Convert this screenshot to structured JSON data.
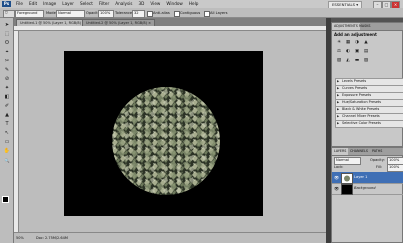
{
  "app": {
    "logo": "Ps"
  },
  "menu": [
    "File",
    "Edit",
    "Image",
    "Layer",
    "Select",
    "Filter",
    "Analysis",
    "3D",
    "View",
    "Window",
    "Help"
  ],
  "workspace_label": "ESSENTIALS ▾",
  "window_buttons": {
    "min": "–",
    "max": "□",
    "close": "×"
  },
  "options": {
    "tool_mode": "Foreground",
    "mode_label": "Mode:",
    "mode_value": "Normal",
    "opacity_label": "Opacity:",
    "opacity_value": "100%",
    "tolerance_label": "Tolerance:",
    "tolerance_value": "32",
    "antialias_label": "Anti-alias",
    "contiguous_label": "Contiguous",
    "all_layers_label": "All Layers"
  },
  "document_tabs": [
    {
      "label": "Untitled-1 @ 50% (Layer 1, RGB/8) ×",
      "active": true
    },
    {
      "label": "Untitled-2 @ 50% (Layer 1, RGB/8) ×",
      "active": false
    }
  ],
  "status": {
    "zoom": "50%",
    "doc": "Doc: 2.75M/2.64M"
  },
  "adjustments_panel": {
    "tabs": [
      "ADJUSTMENTS",
      "MASKS"
    ],
    "title": "Add an adjustment",
    "icons_row1": [
      "☀",
      "▦",
      "◑",
      "▲"
    ],
    "icons_row2": [
      "⚖",
      "◐",
      "▣",
      "▤"
    ],
    "icons_row3": [
      "▧",
      "◭",
      "▬",
      "▨"
    ],
    "presets": [
      "Levels Presets",
      "Curves Presets",
      "Exposure Presets",
      "Hue/Saturation Presets",
      "Black & White Presets",
      "Channel Mixer Presets",
      "Selective Color Presets"
    ]
  },
  "layers_panel": {
    "tabs": [
      "LAYERS",
      "CHANNELS",
      "PATHS"
    ],
    "blend_mode": "Normal",
    "opacity_label": "Opacity:",
    "opacity_value": "100%",
    "fill_label": "Fill:",
    "fill_value": "100%",
    "lock_label": "Lock:",
    "layers": [
      {
        "name": "Layer 1",
        "selected": true
      },
      {
        "name": "Background",
        "selected": false
      }
    ]
  },
  "tools": [
    "➤",
    "⬚",
    "ʘ",
    "⌖",
    "✂",
    "✎",
    "⊘",
    "✦",
    "◧",
    "✐",
    "▲",
    "T",
    "↖",
    "▭",
    "✋",
    "🔍"
  ],
  "colors": {
    "canvas": "#000000",
    "accent_selected": "#3f6fb5"
  }
}
